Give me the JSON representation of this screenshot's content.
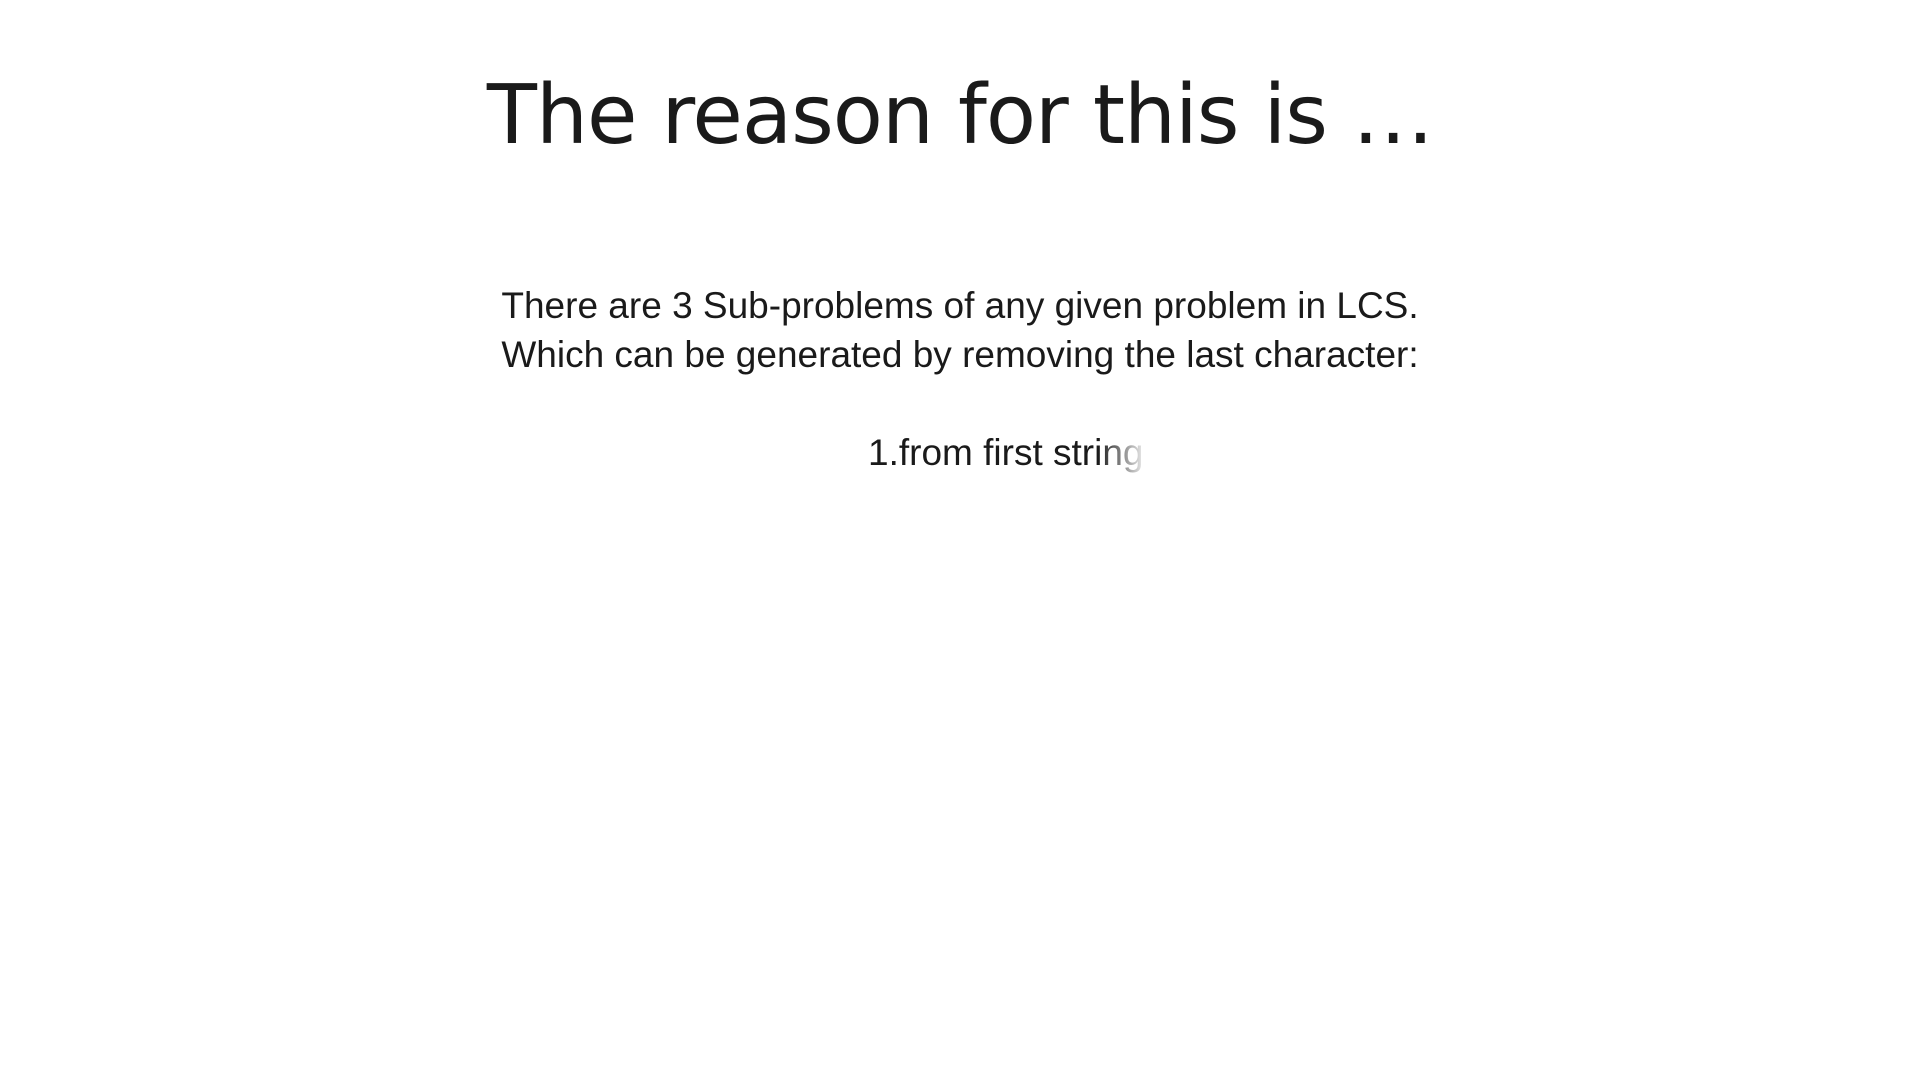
{
  "slide": {
    "title": "The reason for this is …",
    "body": {
      "line1": "There are 3 Sub-problems of any given problem in LCS.",
      "line2": "Which can be generated by removing the last character:",
      "list_items": [
        "1.from first string"
      ]
    }
  }
}
